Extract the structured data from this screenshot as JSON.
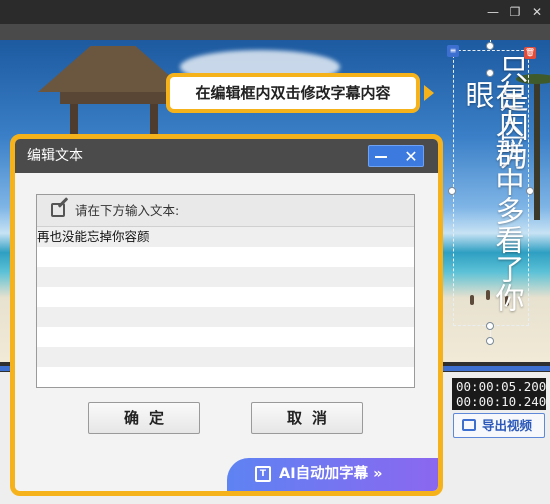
{
  "app": {
    "minimize_icon": "minimize-icon",
    "restore_icon": "restore-icon",
    "close_icon": "close-icon"
  },
  "hint": {
    "text": "在编辑框内双击修改字幕内容"
  },
  "subtitle_preview": {
    "column_right": "只是因为",
    "column_left": "在人群中多看了你眼"
  },
  "timecodes": {
    "current": "00:00:05.200",
    "total": "00:00:10.240"
  },
  "export_button": {
    "label": "导出视频"
  },
  "dialog": {
    "title": "编辑文本",
    "prompt_label": "请在下方输入文本:",
    "lines": [
      "再也没能忘掉你容颜",
      "",
      "",
      "",
      "",
      "",
      "",
      ""
    ],
    "confirm_label": "确定",
    "cancel_label": "取消",
    "ai_label": "AI自动加字幕 »"
  },
  "colors": {
    "accent_yellow": "#f6b21a",
    "accent_blue": "#3c7ae0",
    "ai_gradient_start": "#5e83f2",
    "ai_gradient_end": "#8b67f0"
  }
}
